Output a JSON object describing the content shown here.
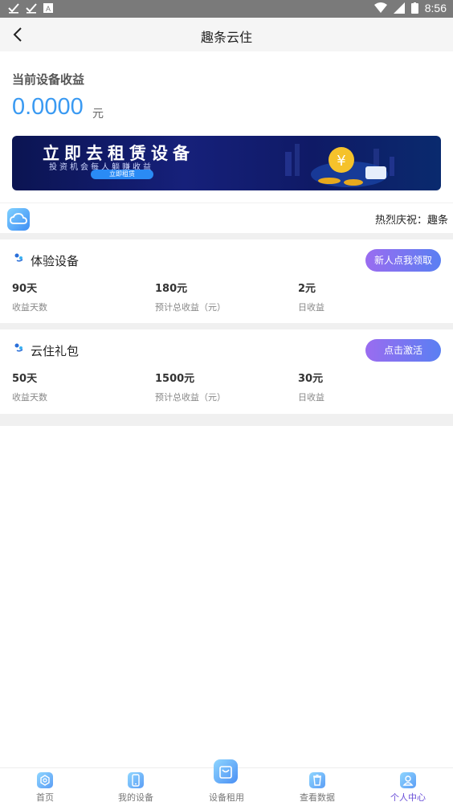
{
  "status": {
    "time": "8:56"
  },
  "header": {
    "title": "趣条云住"
  },
  "earnings": {
    "label": "当前设备收益",
    "amount": "0.0000",
    "unit": "元"
  },
  "banner": {
    "title": "立即去租赁设备",
    "subtitle": "投资机会每人躺赚收益",
    "button": "立即租赁"
  },
  "notice": {
    "text": "热烈庆祝：趣条"
  },
  "cards": [
    {
      "title": "体验设备",
      "button": "新人点我领取",
      "stats": [
        {
          "value": "90天",
          "label": "收益天数"
        },
        {
          "value": "180元",
          "label": "预计总收益（元）"
        },
        {
          "value": "2元",
          "label": "日收益"
        }
      ]
    },
    {
      "title": "云住礼包",
      "button": "点击激活",
      "stats": [
        {
          "value": "50天",
          "label": "收益天数"
        },
        {
          "value": "1500元",
          "label": "预计总收益（元）"
        },
        {
          "value": "30元",
          "label": "日收益"
        }
      ]
    }
  ],
  "nav": [
    {
      "label": "首页",
      "icon": "home-icon"
    },
    {
      "label": "我的设备",
      "icon": "phone-icon"
    },
    {
      "label": "设备租用",
      "icon": "bag-icon"
    },
    {
      "label": "查看数据",
      "icon": "trash-icon"
    },
    {
      "label": "个人中心",
      "icon": "person-icon",
      "active": true
    }
  ]
}
